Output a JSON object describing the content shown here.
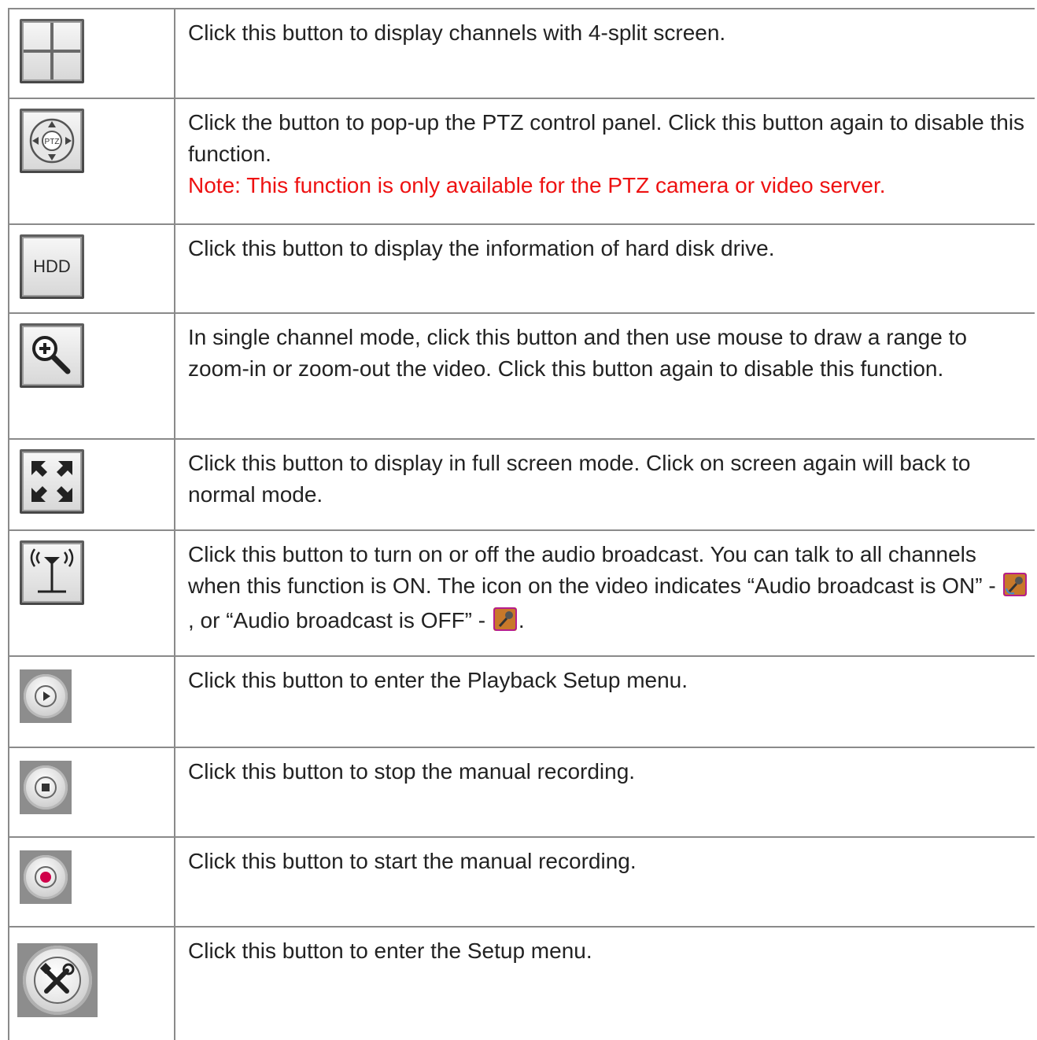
{
  "rows": [
    {
      "icon": "four-split-icon",
      "text": "Click this button to display channels with 4-split screen."
    },
    {
      "icon": "ptz-icon",
      "icon_label": "PTZ",
      "text": "Click the button to pop-up the PTZ control panel. Click this button again to disable this function.",
      "note": "Note: This function is only available for the PTZ camera or video server."
    },
    {
      "icon": "hdd-icon",
      "icon_label": "HDD",
      "text": "Click this button to display the information of hard disk drive."
    },
    {
      "icon": "zoom-icon",
      "text": "In single channel mode, click this button and then use mouse to draw a range to zoom-in or zoom-out the video. Click this button again to disable this function."
    },
    {
      "icon": "fullscreen-icon",
      "text": "Click this button to display in full screen mode. Click on screen again will back to normal mode."
    },
    {
      "icon": "audio-broadcast-icon",
      "text_a": "Click this button to turn on or off the audio broadcast. You can talk to all channels when this function is ON. The icon on the video indicates “Audio broadcast is ON” - ",
      "text_b": ", or “Audio broadcast is OFF” - ",
      "text_c": "."
    },
    {
      "icon": "play-icon",
      "text": "Click this button to enter the Playback Setup menu."
    },
    {
      "icon": "stop-icon",
      "text": "Click this button to stop the manual recording."
    },
    {
      "icon": "record-icon",
      "text": "Click this button to start the manual recording."
    },
    {
      "icon": "setup-tools-icon",
      "text": "Click this button to enter the Setup menu."
    }
  ],
  "colors": {
    "note": "#ee1111",
    "record_dot": "#d0004a",
    "border": "#8a8a8a"
  }
}
